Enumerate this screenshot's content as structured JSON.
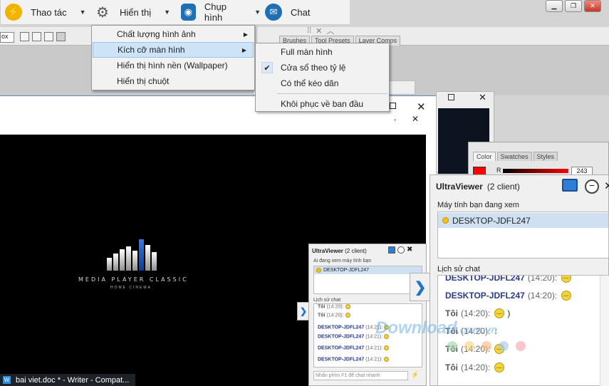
{
  "toolbar": {
    "thao_tac": "Thao tác",
    "hien_thi": "Hiển thị",
    "chup_hinh": "Chụp hình",
    "chat": "Chat",
    "colors": {
      "thao_tac_icon": "#f0b400",
      "chup_icon": "#1f6fb5",
      "chat_icon": "#1f6fb5"
    }
  },
  "hien_thi_menu": {
    "items": [
      {
        "label": "Chất lượng hình ảnh",
        "has_submenu": true
      },
      {
        "label": "Kích cỡ màn hình",
        "has_submenu": true,
        "highlighted": true
      },
      {
        "label": "Hiển thị hình nền (Wallpaper)"
      },
      {
        "label": "Hiển thị chuột"
      }
    ]
  },
  "kich_co_submenu": {
    "items": [
      {
        "label": "Full màn hình"
      },
      {
        "label": "Cửa sổ theo tỷ lệ",
        "checked": true
      },
      {
        "label": "Có thể kéo dãn"
      },
      {
        "label": "Khôi phục về ban đầu"
      }
    ]
  },
  "photoshop": {
    "tabs": [
      "Brushes",
      "Tool Presets",
      "Layer Comps"
    ],
    "color_tabs": [
      "Color",
      "Swatches",
      "Styles"
    ],
    "r_label": "R",
    "r_value": "243",
    "box_text": "ox"
  },
  "player": {
    "logo_title": "MEDIA PLAYER CLASSIC",
    "logo_subtitle": "HOME CINEMA"
  },
  "ultraviewer": {
    "title": "UltraViewer",
    "clients": "(2 client)",
    "viewing_label": "Máy tính bạn đang xem",
    "computer_name": "DESKTOP-JDFL247",
    "history_label": "Lịch sử chat",
    "chat": [
      {
        "name": "DESKTOP-JDFL247",
        "time": "(14:20):",
        "kind": "remote",
        "text": ""
      },
      {
        "name": "DESKTOP-JDFL247",
        "time": "(14:20):",
        "kind": "remote",
        "text": ""
      },
      {
        "name": "Tôi",
        "time": "(14:20):",
        "kind": "me",
        "text": ")"
      },
      {
        "name": "Tôi",
        "time": "(14:20):",
        "kind": "me",
        "text": ":"
      },
      {
        "name": "Tôi",
        "time": "(14:20):",
        "kind": "me",
        "text": ""
      },
      {
        "name": "Tôi",
        "time": "(14:20):",
        "kind": "me",
        "text": ""
      }
    ]
  },
  "small_ultraviewer": {
    "title": "UltraViewer",
    "clients": "(2 client)",
    "viewing_label": "Ai đang xem máy tính bạn",
    "computer_name": "DESKTOP-JDFL247",
    "history_label": "Lịch sử chat",
    "chat": [
      {
        "name": "Tôi",
        "time": "(14:20):"
      },
      {
        "name": "Tôi",
        "time": "(14:20):"
      },
      {
        "name": "DESKTOP-JDFL247",
        "time": "(14:21):"
      },
      {
        "name": "DESKTOP-JDFL247",
        "time": "(14:21):"
      },
      {
        "name": "DESKTOP-JDFL247",
        "time": "(14:21):"
      },
      {
        "name": "DESKTOP-JDFL247",
        "time": "(14:21):"
      }
    ],
    "input_placeholder": "Nhấn phím F1 để chat nhanh"
  },
  "taskbar": {
    "label": "bai viet.doc * - Writer - Compat..."
  },
  "watermark": {
    "text": "Download",
    "suffix": ".com.vn"
  }
}
